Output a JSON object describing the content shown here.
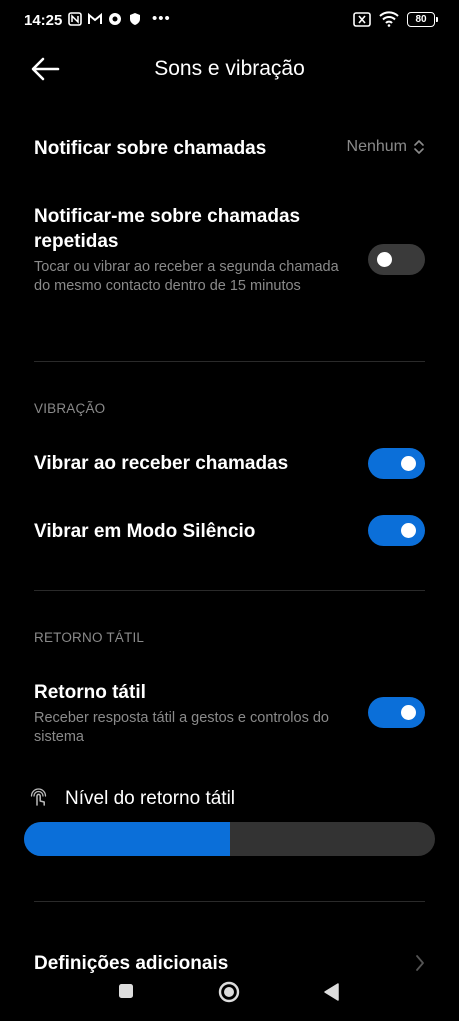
{
  "status_bar": {
    "time": "14:25",
    "more": "•••",
    "battery": "80"
  },
  "header": {
    "title": "Sons e vibração"
  },
  "settings": {
    "notify_calls": {
      "label": "Notificar sobre chamadas",
      "value": "Nenhum"
    },
    "repeat_calls": {
      "label": "Notificar-me sobre chamadas repetidas",
      "description": "Tocar ou vibrar ao receber a segunda chamada do mesmo contacto dentro de 15 minutos",
      "enabled": false
    }
  },
  "vibration": {
    "section_title": "VIBRAÇÃO",
    "ring_vibrate": {
      "label": "Vibrar ao receber chamadas",
      "enabled": true
    },
    "silent_vibrate": {
      "label": "Vibrar em Modo Silêncio",
      "enabled": true
    }
  },
  "haptics": {
    "section_title": "RETORNO TÁTIL",
    "haptic": {
      "label": "Retorno tátil",
      "description": "Receber resposta tátil a gestos e controlos do sistema",
      "enabled": true
    },
    "level": {
      "label": "Nível do retorno tátil",
      "value": 0.5
    }
  },
  "additional": {
    "label": "Definições adicionais"
  },
  "colors": {
    "accent": "#0b6fd9",
    "toggle_off": "#3a3a3a",
    "secondary_text": "#8a8a8a"
  },
  "icons": {
    "back": "arrow-left-icon",
    "updown": "chevron-updown-icon",
    "chevron_right": "chevron-right-icon",
    "haptic": "haptic-touch-icon",
    "nav_recents": "square-icon",
    "nav_home": "circle-icon",
    "nav_back": "triangle-back-icon"
  }
}
